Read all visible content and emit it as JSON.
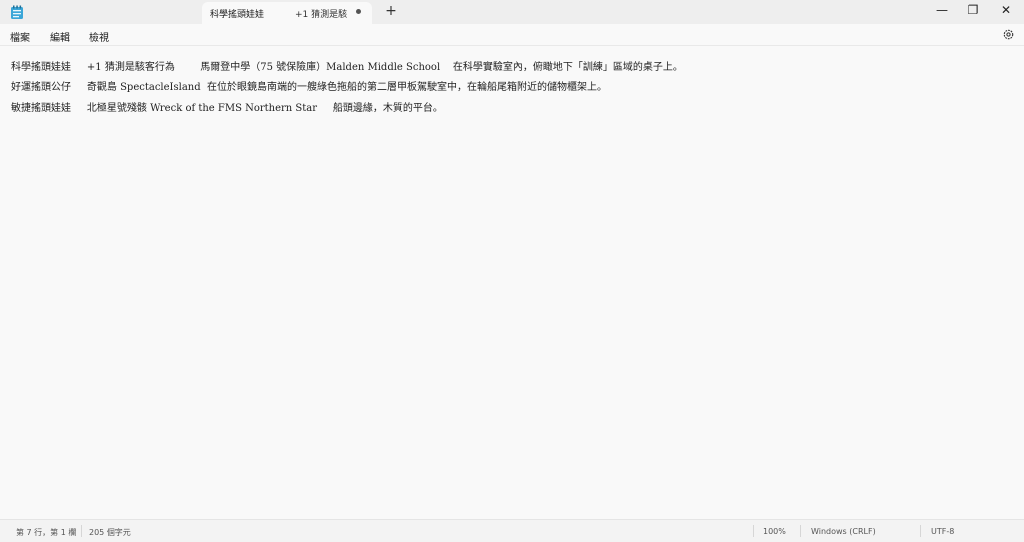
{
  "app": {
    "tabs": [
      {
        "title": "科學搖頭娃娃"
      },
      {
        "title": "+1 猜測是駭客"
      }
    ]
  },
  "window_controls": {
    "minimize": "—",
    "restore": "❐",
    "close": "✕"
  },
  "menu": [
    "檔案",
    "編輯",
    "檢視"
  ],
  "content": {
    "lines": [
      "科學搖頭娃娃     +1 猜測是駭客行為        馬爾登中學（75 號保險庫）Malden Middle School    在科學實驗室內，俯瞰地下「訓練」區域的桌子上。",
      "好運搖頭公仔     奇觀島 SpectacleIsland  在位於眼鏡島南端的一艘綠色拖船的第二層甲板駕駛室中，在輪船尾箱附近的儲物櫃架上。",
      "敏捷搖頭娃娃     北極星號殘骸 Wreck of the FMS Northern Star     船頭邊緣，木質的平台。"
    ]
  },
  "status": {
    "position": "第 7 行，第 1 欄",
    "chars": "205 個字元",
    "zoom": "100%",
    "line_ending": "Windows (CRLF)",
    "encoding": "UTF-8"
  }
}
